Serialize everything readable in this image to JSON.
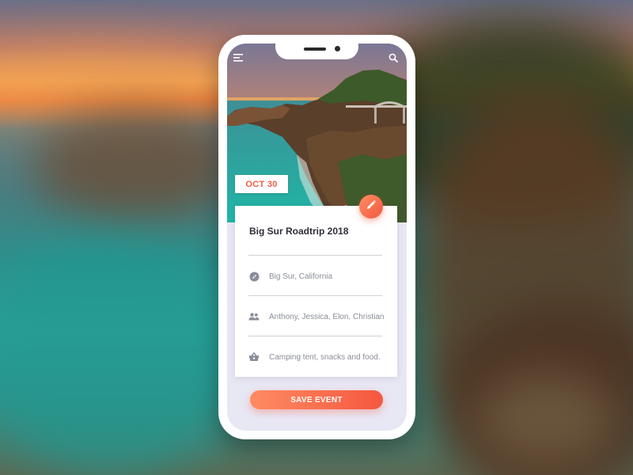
{
  "event": {
    "date": "OCT 30",
    "title": "Big Sur Roadtrip 2018",
    "location": "Big Sur, California",
    "people": "Anthony, Jessica, Elon, Christian",
    "items": "Camping tent, snacks and food."
  },
  "actions": {
    "save_label": "SAVE EVENT"
  },
  "icons": {
    "menu": "hamburger-menu-icon",
    "search": "search-icon",
    "edit": "pencil-icon",
    "location": "compass-icon",
    "people": "people-group-icon",
    "items": "basket-icon"
  },
  "colors": {
    "accent": "#f5573f",
    "accent_light": "#ff8b62",
    "text_dark": "#2f2f3a",
    "text_muted": "#8a8d99",
    "screen_bg": "#e8e7f4"
  }
}
